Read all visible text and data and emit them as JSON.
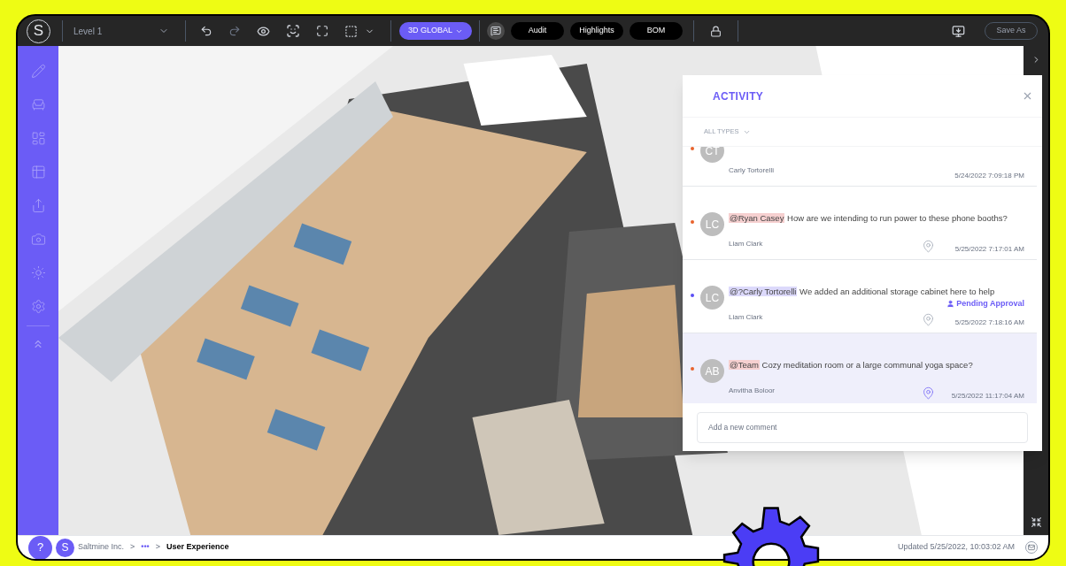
{
  "toolbar": {
    "logo": "S",
    "level": "Level 1",
    "view": "3D GLOBAL",
    "buttons": [
      "Audit",
      "Highlights",
      "BOM"
    ],
    "save": "Save As"
  },
  "activity": {
    "title": "ACTIVITY",
    "filter": "ALL TYPES",
    "comments": [
      {
        "initials": "CT",
        "author": "Carly Tortorelli",
        "date": "5/24/2022 7:09:18 PM",
        "color": "#e8622c",
        "pin": false,
        "selected": false
      },
      {
        "initials": "LC",
        "mention": {
          "text": "@Ryan Casey",
          "color": "#f6d0d0"
        },
        "text": "How are we intending to run power to these phone booths?",
        "author": "Liam Clark",
        "date": "5/25/2022 7:17:01 AM",
        "color": "#e8622c",
        "pin": true,
        "selected": false
      },
      {
        "initials": "LC",
        "mention": {
          "text": "@?Carly Tortorelli",
          "color": "#dcd9fb"
        },
        "text": "We added an additional storage cabinet here to help",
        "status": "Pending Approval",
        "author": "Liam Clark",
        "date": "5/25/2022 7:18:16 AM",
        "color": "#5b4ff5",
        "pin": true,
        "selected": false
      },
      {
        "initials": "AB",
        "mention": {
          "text": "@Team",
          "color": "#f6d0d0"
        },
        "text": "Cozy meditation room or a large communal yoga space?",
        "author": "Anvitha Boloor",
        "date": "5/25/2022 11:17:04 AM",
        "color": "#e8622c",
        "pin": true,
        "selected": true
      }
    ],
    "placeholder": "Add a new comment"
  },
  "footer": {
    "help": "?",
    "avatar": "S",
    "separator": ">",
    "breadcrumbs": [
      {
        "label": "Saltmine Inc.",
        "current": false
      },
      {
        "label": "•••",
        "current": false
      },
      {
        "label": "User Experience",
        "current": true
      }
    ],
    "updated": "Updated 5/25/2022, 10:03:02 AM"
  }
}
